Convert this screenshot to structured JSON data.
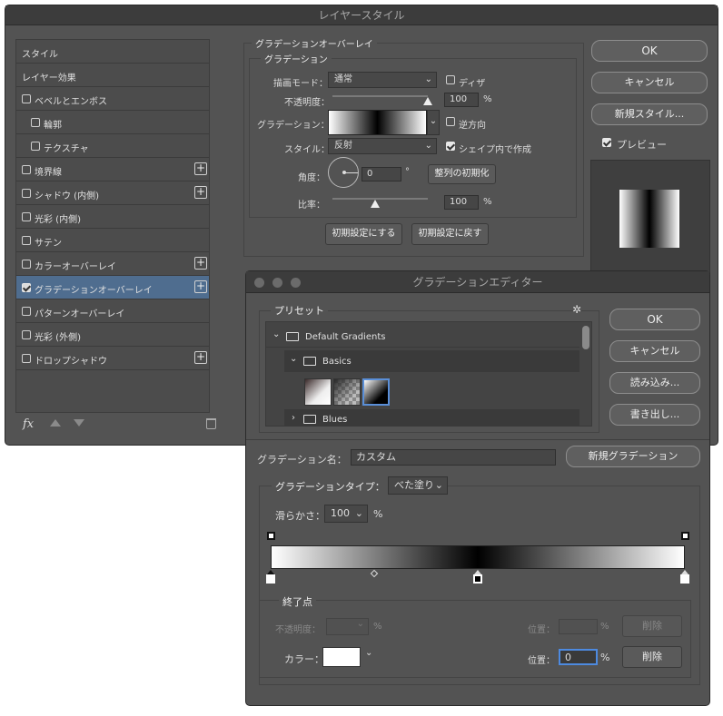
{
  "layer_style": {
    "title": "レイヤースタイル",
    "styles_header": "スタイル",
    "blend_header": "レイヤー効果",
    "effects": [
      {
        "label": "ベベルとエンボス",
        "checked": false,
        "plus": false,
        "indent": false
      },
      {
        "label": "輪郭",
        "checked": false,
        "plus": false,
        "indent": true
      },
      {
        "label": "テクスチャ",
        "checked": false,
        "plus": false,
        "indent": true
      },
      {
        "label": "境界線",
        "checked": false,
        "plus": true,
        "indent": false
      },
      {
        "label": "シャドウ (内側)",
        "checked": false,
        "plus": true,
        "indent": false
      },
      {
        "label": "光彩 (内側)",
        "checked": false,
        "plus": false,
        "indent": false
      },
      {
        "label": "サテン",
        "checked": false,
        "plus": false,
        "indent": false
      },
      {
        "label": "カラーオーバーレイ",
        "checked": false,
        "plus": true,
        "indent": false
      },
      {
        "label": "グラデーションオーバーレイ",
        "checked": true,
        "plus": true,
        "indent": false,
        "selected": true
      },
      {
        "label": "パターンオーバーレイ",
        "checked": false,
        "plus": false,
        "indent": false
      },
      {
        "label": "光彩 (外側)",
        "checked": false,
        "plus": false,
        "indent": false
      },
      {
        "label": "ドロップシャドウ",
        "checked": false,
        "plus": true,
        "indent": false
      }
    ],
    "fx_label": "fx",
    "panel_title": "グラデーションオーバーレイ",
    "sub_title": "グラデーション",
    "blend_mode_label": "描画モード：",
    "blend_mode_value": "通常",
    "dither_label": "ディザ",
    "dither_checked": false,
    "opacity_label": "不透明度：",
    "opacity_value": "100",
    "opacity_pct": "%",
    "opacity_fraction": 1.0,
    "gradient_label": "グラデーション：",
    "reverse_label": "逆方向",
    "reverse_checked": false,
    "style_label": "スタイル：",
    "style_value": "反射",
    "align_label": "シェイプ内で作成",
    "align_checked": true,
    "angle_label": "角度：",
    "angle_value": "0",
    "angle_unit": "°",
    "reset_align_button": "整列の初期化",
    "scale_label": "比率：",
    "scale_value": "100",
    "scale_pct": "%",
    "scale_fraction": 0.45,
    "make_default_button": "初期設定にする",
    "reset_default_button": "初期設定に戻す",
    "ok_button": "OK",
    "cancel_button": "キャンセル",
    "new_style_button": "新規スタイル...",
    "preview_label": "プレビュー",
    "preview_checked": true
  },
  "gradient_editor": {
    "title": "グラデーションエディター",
    "presets_label": "プリセット",
    "gear_icon": "gear-icon",
    "folders": [
      {
        "name": "Default Gradients",
        "expanded": true
      },
      {
        "name": "Basics",
        "expanded": true
      },
      {
        "name": "Blues",
        "expanded": false
      }
    ],
    "ok_button": "OK",
    "cancel_button": "キャンセル",
    "load_button": "読み込み...",
    "save_button": "書き出し...",
    "name_label": "グラデーション名：",
    "name_value": "カスタム",
    "new_gradient_button": "新規グラデーション",
    "type_label": "グラデーションタイプ：",
    "type_value": "べた塗り",
    "smooth_label": "滑らかさ：",
    "smooth_value": "100",
    "smooth_pct": "%",
    "stops_group": "終了点",
    "stop_opacity_label": "不透明度：",
    "stop_opacity_pct": "%",
    "stop_location_label": "位置：",
    "stop_location_pct": "%",
    "delete_button": "削除",
    "color_label": "カラー：",
    "color_location_label": "位置：",
    "color_location_value": "0",
    "color_location_pct": "%",
    "color_delete_button": "削除",
    "stop_color": "#ffffff",
    "color_stops": [
      0,
      0.5,
      1
    ],
    "opacity_stops": [
      0,
      1
    ],
    "midpoint": 0.25
  }
}
